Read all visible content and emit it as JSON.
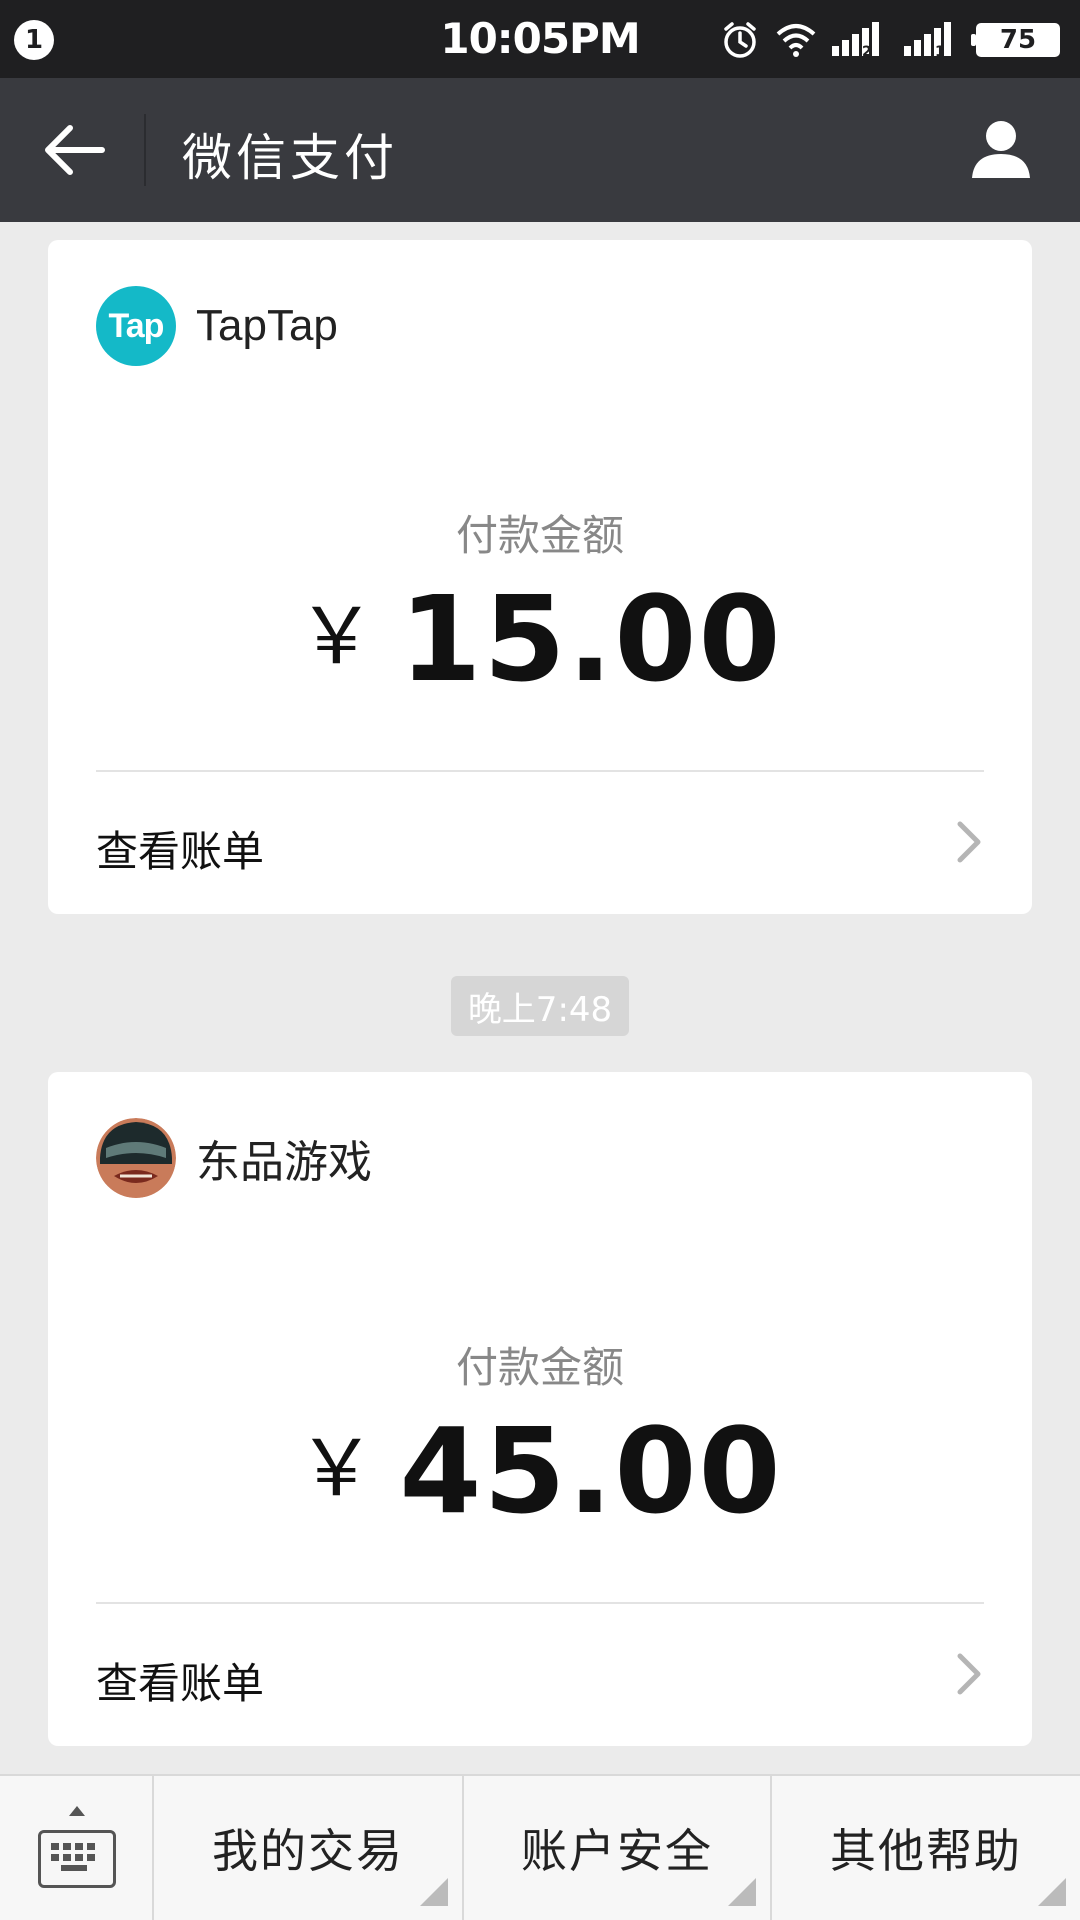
{
  "status_bar": {
    "notification_count": "1",
    "time": "10:05PM",
    "battery": "75",
    "icons": [
      "alarm-icon",
      "wifi-icon",
      "signal-sim2-icon",
      "signal-sim1-icon",
      "battery-icon"
    ]
  },
  "header": {
    "title": "微信支付",
    "back_icon": "arrow-left-icon",
    "profile_icon": "person-icon"
  },
  "payments": [
    {
      "merchant": "TapTap",
      "merchant_logo_text": "Tap",
      "amount_label": "付款金额",
      "currency": "￥",
      "amount": "15.00",
      "bill_link": "查看账单"
    },
    {
      "merchant": "东品游戏",
      "amount_label": "付款金额",
      "currency": "￥",
      "amount": "45.00",
      "bill_link": "查看账单"
    }
  ],
  "timestamp": "晚上7:48",
  "bottom_menu": {
    "keyboard_icon": "keyboard-icon",
    "items": [
      "我的交易",
      "账户安全",
      "其他帮助"
    ]
  },
  "colors": {
    "status_bar_bg": "#1f1f21",
    "title_bar_bg": "#393a3f",
    "page_bg": "#ebebeb",
    "taptap_brand": "#14b9c8"
  }
}
